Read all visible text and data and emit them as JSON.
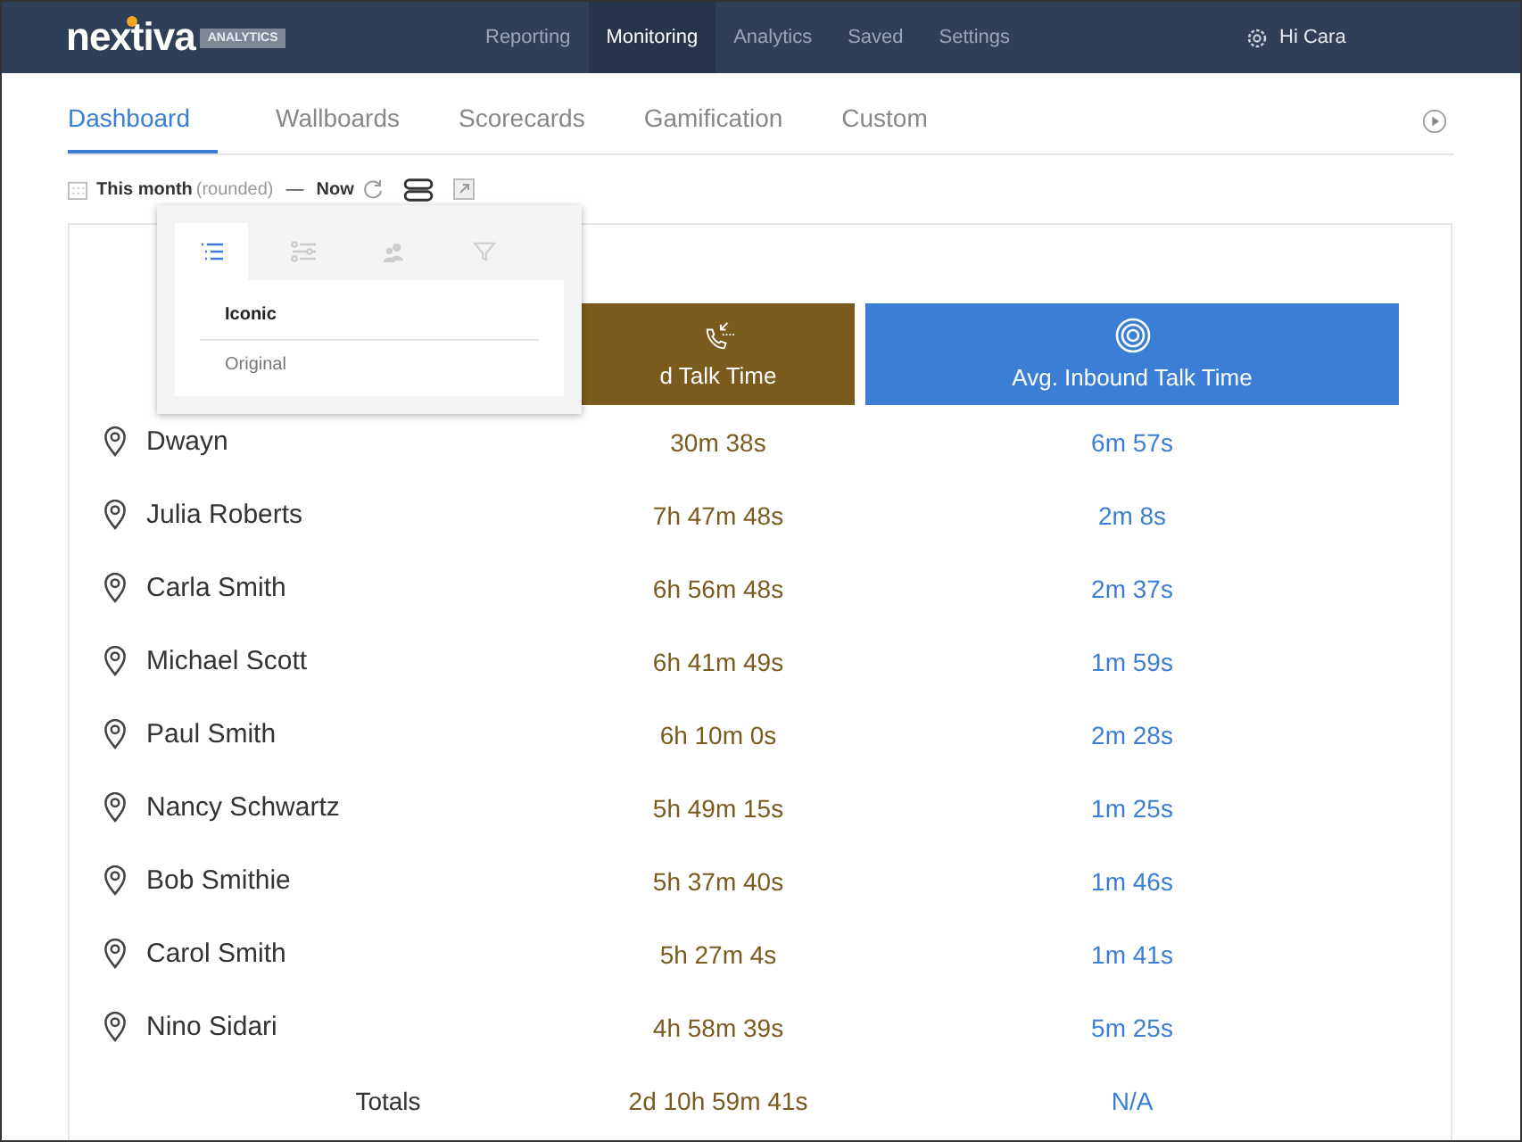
{
  "header": {
    "brand": "nextiva",
    "badge": "ANALYTICS",
    "menu": [
      {
        "label": "Reporting",
        "selected": false
      },
      {
        "label": "Monitoring",
        "selected": true
      },
      {
        "label": "Analytics",
        "selected": false
      },
      {
        "label": "Saved",
        "selected": false
      },
      {
        "label": "Settings",
        "selected": false
      }
    ],
    "user": "Hi Cara"
  },
  "tabs": [
    {
      "label": "Dashboard",
      "selected": true
    },
    {
      "label": "Wallboards",
      "selected": false
    },
    {
      "label": "Scorecards",
      "selected": false
    },
    {
      "label": "Gamification",
      "selected": false
    },
    {
      "label": "Custom",
      "selected": false
    }
  ],
  "toolbar": {
    "range": "This month",
    "note": "(rounded)",
    "dash": "—",
    "end": "Now"
  },
  "popup": {
    "tabs": [
      {
        "kind": "list",
        "selected": true
      },
      {
        "kind": "sliders",
        "selected": false
      },
      {
        "kind": "people",
        "selected": false
      },
      {
        "kind": "filter",
        "selected": false
      }
    ],
    "options": [
      {
        "label": "Iconic",
        "selected": true
      },
      {
        "label": "Original",
        "selected": false
      }
    ]
  },
  "table": {
    "columns": [
      {
        "title": "d Talk Time",
        "kind": "phone",
        "color": "#7b5a1e"
      },
      {
        "title": "Avg. Inbound Talk Time",
        "kind": "target",
        "color": "#3a7fd5"
      }
    ],
    "rows": [
      {
        "name": "Dwayn",
        "values": [
          "30m 38s",
          "6m 57s"
        ]
      },
      {
        "name": "Julia Roberts",
        "values": [
          "7h 47m 48s",
          "2m 8s"
        ]
      },
      {
        "name": "Carla Smith",
        "values": [
          "6h 56m 48s",
          "2m 37s"
        ]
      },
      {
        "name": "Michael Scott",
        "values": [
          "6h 41m 49s",
          "1m 59s"
        ]
      },
      {
        "name": "Paul Smith",
        "values": [
          "6h 10m 0s",
          "2m 28s"
        ]
      },
      {
        "name": "Nancy Schwartz",
        "values": [
          "5h 49m 15s",
          "1m 25s"
        ]
      },
      {
        "name": "Bob Smithie",
        "values": [
          "5h 37m 40s",
          "1m 46s"
        ]
      },
      {
        "name": "Carol Smith",
        "values": [
          "5h 27m 4s",
          "1m 41s"
        ]
      },
      {
        "name": "Nino Sidari",
        "values": [
          "4h 58m 39s",
          "5m 25s"
        ]
      }
    ],
    "totals": {
      "label": "Totals",
      "values": [
        "2d 10h 59m 41s",
        "N/A"
      ]
    }
  }
}
